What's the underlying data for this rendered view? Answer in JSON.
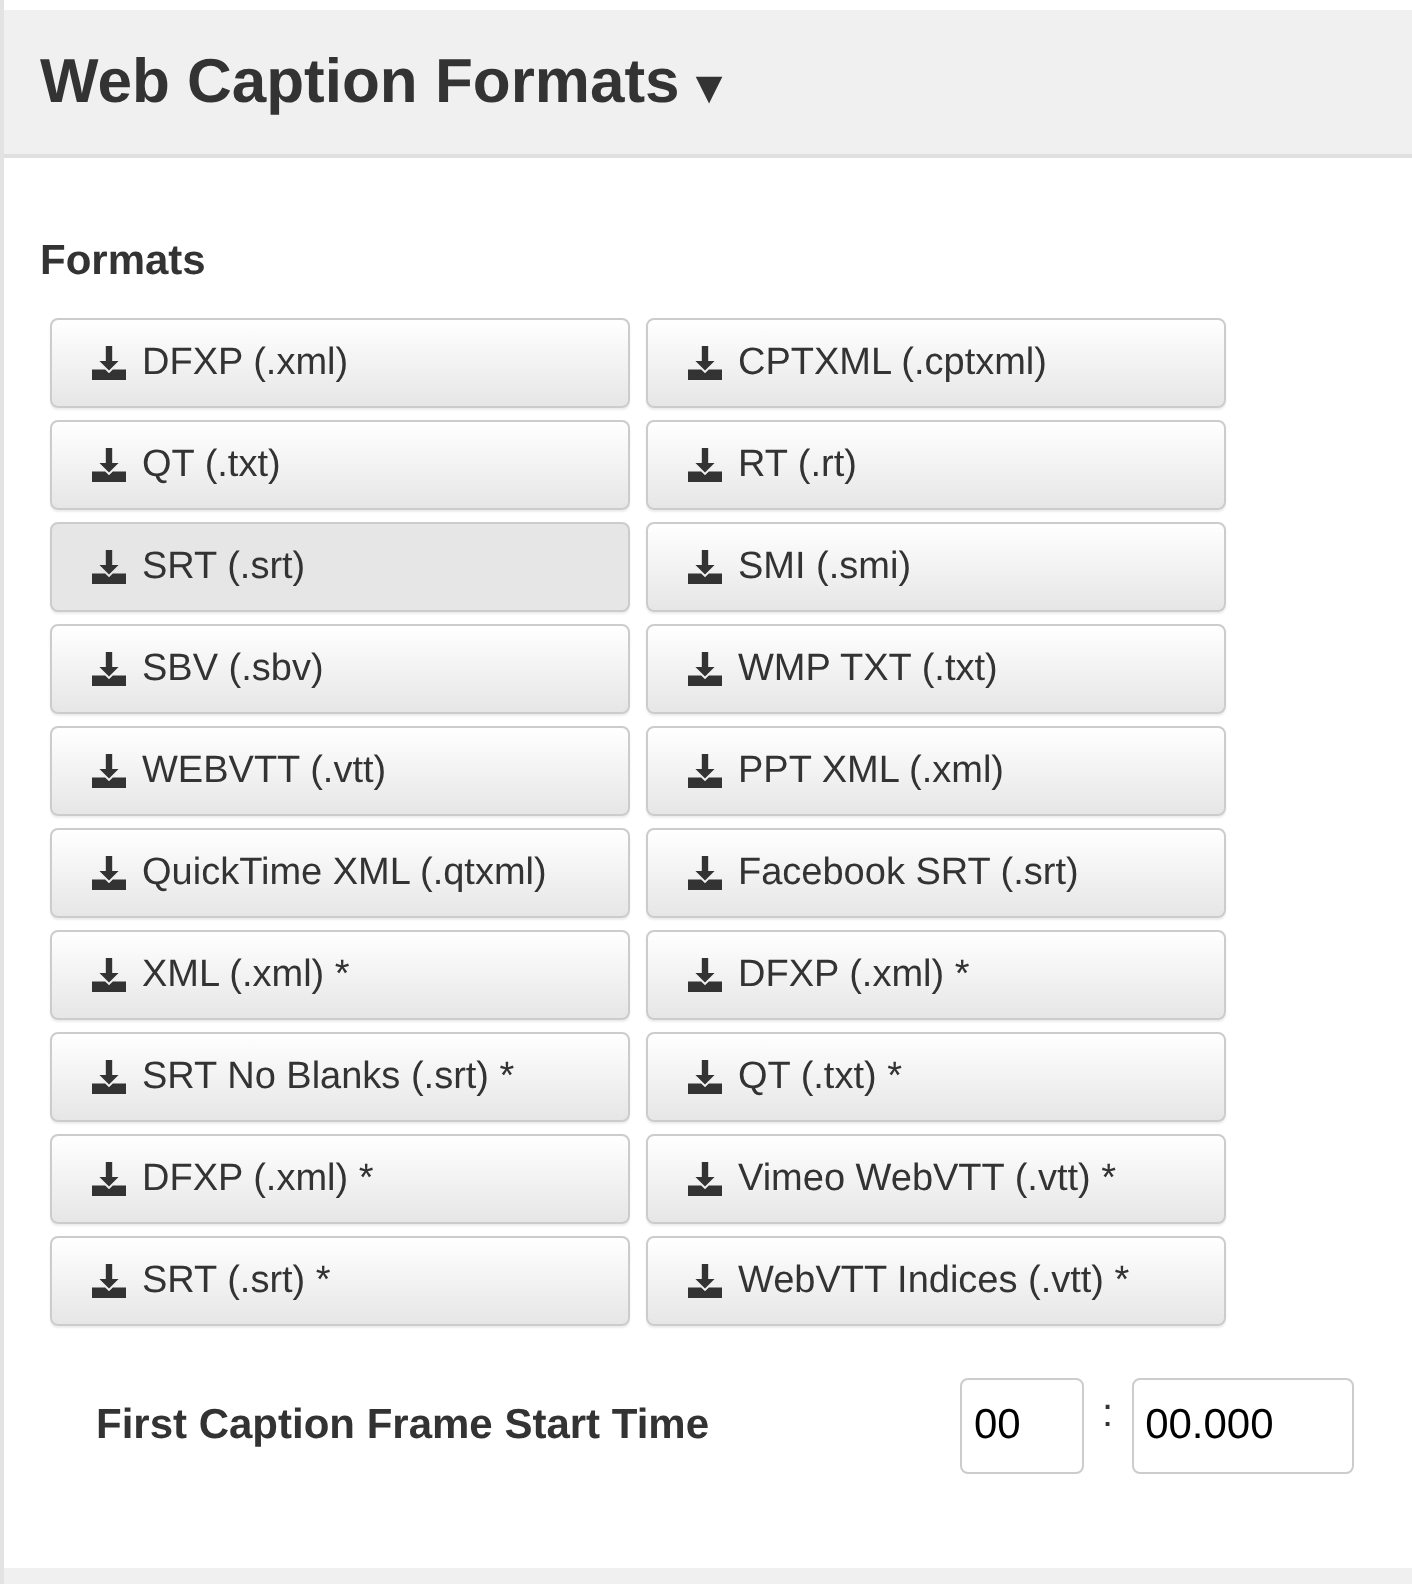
{
  "header": {
    "title": "Web Caption Formats",
    "caret": "▾"
  },
  "section_label": "Formats",
  "format_rows": [
    [
      {
        "label": "DFXP (.xml)",
        "hover": false
      },
      {
        "label": "CPTXML (.cptxml)",
        "hover": false
      }
    ],
    [
      {
        "label": "QT (.txt)",
        "hover": false
      },
      {
        "label": "RT (.rt)",
        "hover": false
      }
    ],
    [
      {
        "label": "SRT (.srt)",
        "hover": true
      },
      {
        "label": "SMI (.smi)",
        "hover": false
      }
    ],
    [
      {
        "label": "SBV (.sbv)",
        "hover": false
      },
      {
        "label": "WMP TXT (.txt)",
        "hover": false
      }
    ],
    [
      {
        "label": "WEBVTT (.vtt)",
        "hover": false
      },
      {
        "label": "PPT XML (.xml)",
        "hover": false
      }
    ],
    [
      {
        "label": "QuickTime XML (.qtxml)",
        "hover": false
      },
      {
        "label": "Facebook SRT (.srt)",
        "hover": false
      }
    ],
    [
      {
        "label": "XML (.xml) *",
        "hover": false
      },
      {
        "label": "DFXP (.xml) *",
        "hover": false
      }
    ],
    [
      {
        "label": "SRT No Blanks (.srt) *",
        "hover": false
      },
      {
        "label": "QT (.txt) *",
        "hover": false
      }
    ],
    [
      {
        "label": "DFXP (.xml) *",
        "hover": false
      },
      {
        "label": "Vimeo WebVTT (.vtt) *",
        "hover": false
      }
    ],
    [
      {
        "label": "SRT (.srt) *",
        "hover": false
      },
      {
        "label": "WebVTT Indices (.vtt) *",
        "hover": false
      }
    ]
  ],
  "start_time": {
    "label": "First Caption Frame Start Time",
    "minutes": "00",
    "separator": ":",
    "seconds": "00.000"
  }
}
